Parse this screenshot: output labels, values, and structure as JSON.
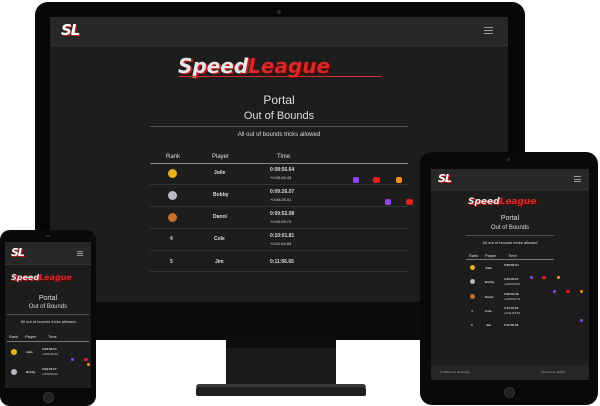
{
  "logo_short": "SL",
  "brand": {
    "part1": "Speed",
    "part2": "League"
  },
  "title": "Portal",
  "subtitle": "Out of Bounds",
  "description": "All out of bounds tricks allowed",
  "table": {
    "headers": {
      "rank": "Rank",
      "player": "Player",
      "time": "Time"
    },
    "rows": [
      {
        "rank": "",
        "medal": "gold",
        "player": "Jolle",
        "time": "0:08:56.64",
        "delta": ""
      },
      {
        "rank": "",
        "medal": "silver",
        "player": "Bobby",
        "time": "0:09:26.07",
        "delta": "+0:00:26.01"
      },
      {
        "rank": "",
        "medal": "bronze",
        "player": "Danni",
        "time": "0:09:52.08",
        "delta": "+0:00:09.73"
      },
      {
        "rank": "4",
        "medal": "",
        "player": "Cole",
        "time": "0:10:01.81",
        "delta": "+0:01:54.84"
      },
      {
        "rank": "5",
        "medal": "",
        "player": "Jim",
        "time": "0:11:56.65",
        "delta": ""
      }
    ]
  },
  "desktop_deltas": [
    "+0:00:26.43",
    "+0:00:26.01",
    "+0:00:09.73",
    "+0:01:54.84",
    ""
  ],
  "footer": {
    "left": "© 2023 Live Humming",
    "right": "Find me on github"
  },
  "colors": {
    "accent_red": "#d42a2a",
    "twitch": "#8e44f0",
    "youtube": "#e41f1f",
    "external": "#ff8c1a",
    "gold": "#e8b21e",
    "silver": "#b8b8c4",
    "bronze": "#c8702e"
  }
}
